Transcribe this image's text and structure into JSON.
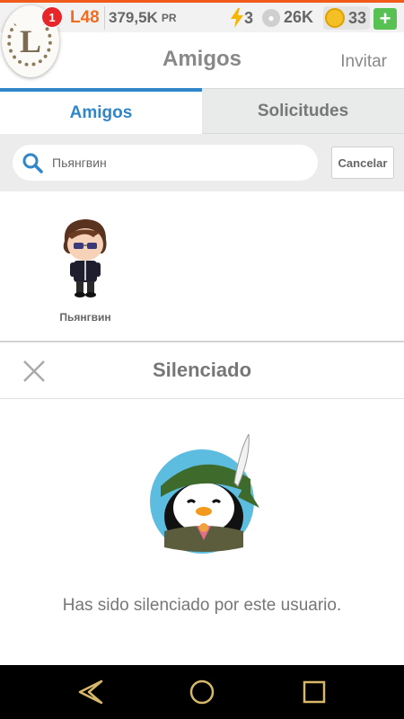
{
  "topbar": {
    "level": "L48",
    "points": "379,5K",
    "points_suffix": "PR",
    "energy": "3",
    "paws": "26K",
    "coins": "33",
    "plus_label": "+",
    "notification_count": "1",
    "logo_letter": "L"
  },
  "header": {
    "title": "Amigos",
    "invite_label": "Invitar"
  },
  "tabs": [
    {
      "label": "Amigos",
      "active": true
    },
    {
      "label": "Solicitudes",
      "active": false
    }
  ],
  "search": {
    "value": "Пьянгвин",
    "cancel_label": "Cancelar"
  },
  "results": [
    {
      "name": "Пьянгвин"
    }
  ],
  "muted_panel": {
    "title": "Silenciado",
    "message": "Has sido silenciado por este usuario."
  },
  "colors": {
    "accent": "#2f86c8",
    "orange": "#f36b1e",
    "green": "#57c154",
    "badge": "#e7262a"
  }
}
